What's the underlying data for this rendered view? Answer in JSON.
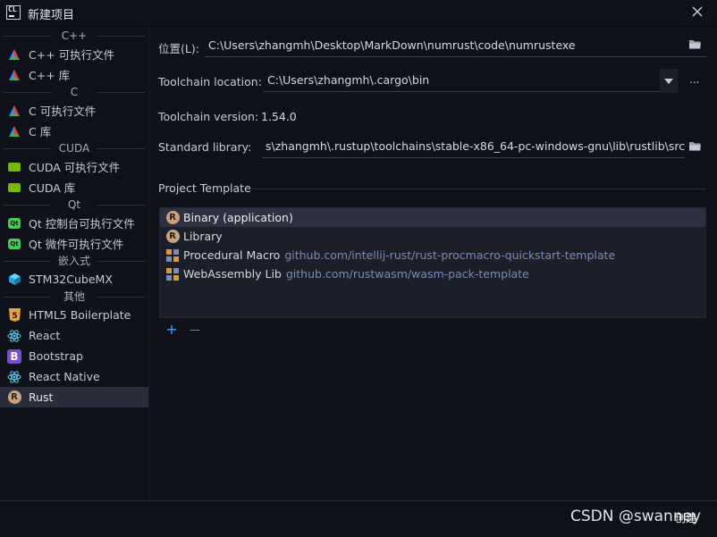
{
  "window": {
    "title": "新建项目",
    "logo_text": "CL"
  },
  "sidebar": {
    "groups": [
      {
        "header": "C++",
        "items": [
          {
            "label": "C++ 可执行文件"
          },
          {
            "label": "C++ 库"
          }
        ]
      },
      {
        "header": "C",
        "items": [
          {
            "label": "C 可执行文件"
          },
          {
            "label": "C 库"
          }
        ]
      },
      {
        "header": "CUDA",
        "items": [
          {
            "label": "CUDA 可执行文件"
          },
          {
            "label": "CUDA 库"
          }
        ]
      },
      {
        "header": "Qt",
        "items": [
          {
            "label": "Qt 控制台可执行文件",
            "icon_text": "Qt"
          },
          {
            "label": "Qt 微件可执行文件",
            "icon_text": "Qt"
          }
        ]
      },
      {
        "header": "嵌入式",
        "items": [
          {
            "label": "STM32CubeMX"
          }
        ]
      },
      {
        "header": "其他",
        "items": [
          {
            "label": "HTML5 Boilerplate",
            "icon_text": "5"
          },
          {
            "label": "React"
          },
          {
            "label": "Bootstrap",
            "icon_text": "B"
          },
          {
            "label": "React Native"
          },
          {
            "label": "Rust",
            "icon_text": "R"
          }
        ]
      }
    ],
    "selected": "Rust"
  },
  "form": {
    "location_label": "位置(L):",
    "location_value": "C:\\Users\\zhangmh\\Desktop\\MarkDown\\numrust\\code\\numrustexe",
    "toolchain_location_label": "Toolchain location:",
    "toolchain_location_value": "C:\\Users\\zhangmh\\.cargo\\bin",
    "toolchain_version_label": "Toolchain version:",
    "toolchain_version_value": "1.54.0",
    "stdlib_label": "Standard library:",
    "stdlib_value": "s\\zhangmh\\.rustup\\toolchains\\stable-x86_64-pc-windows-gnu\\lib\\rustlib\\src\\rust",
    "more_button": "..."
  },
  "templates": {
    "section_title": "Project Template",
    "items": [
      {
        "name": "Binary (application)",
        "url": "",
        "icon_text": "R"
      },
      {
        "name": "Library",
        "url": "",
        "icon_text": "R"
      },
      {
        "name": "Procedural Macro",
        "url": "github.com/intellij-rust/rust-procmacro-quickstart-template"
      },
      {
        "name": "WebAssembly Lib",
        "url": "github.com/rustwasm/wasm-pack-template"
      }
    ],
    "add_label": "+",
    "remove_label": "—"
  },
  "footer": {
    "create_label": "创建",
    "watermark": "CSDN @swanney"
  },
  "colors": {
    "background": "#0f111a",
    "selection": "#2a2d3b",
    "link": "#7b8cb8",
    "accent": "#4a9eff"
  }
}
